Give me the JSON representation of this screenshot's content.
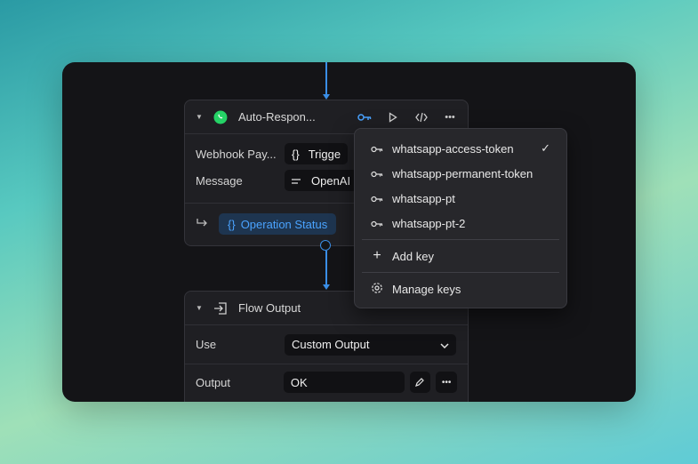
{
  "node1": {
    "title": "Auto-Respon...",
    "rows": [
      {
        "label": "Webhook Pay...",
        "value": "Trigge"
      },
      {
        "label": "Message",
        "value": "OpenAI"
      }
    ],
    "status_label": "Operation Status"
  },
  "dropdown": {
    "keys": [
      {
        "label": "whatsapp-access-token",
        "selected": true
      },
      {
        "label": "whatsapp-permanent-token",
        "selected": false
      },
      {
        "label": "whatsapp-pt",
        "selected": false
      },
      {
        "label": "whatsapp-pt-2",
        "selected": false
      }
    ],
    "add_key": "Add key",
    "manage_keys": "Manage keys"
  },
  "node2": {
    "title": "Flow Output",
    "use_label": "Use",
    "use_value": "Custom Output",
    "output_label": "Output",
    "output_value": "OK"
  },
  "colors": {
    "accent": "#3a8ee6",
    "whatsapp": "#25d366",
    "canvas": "#141417"
  }
}
